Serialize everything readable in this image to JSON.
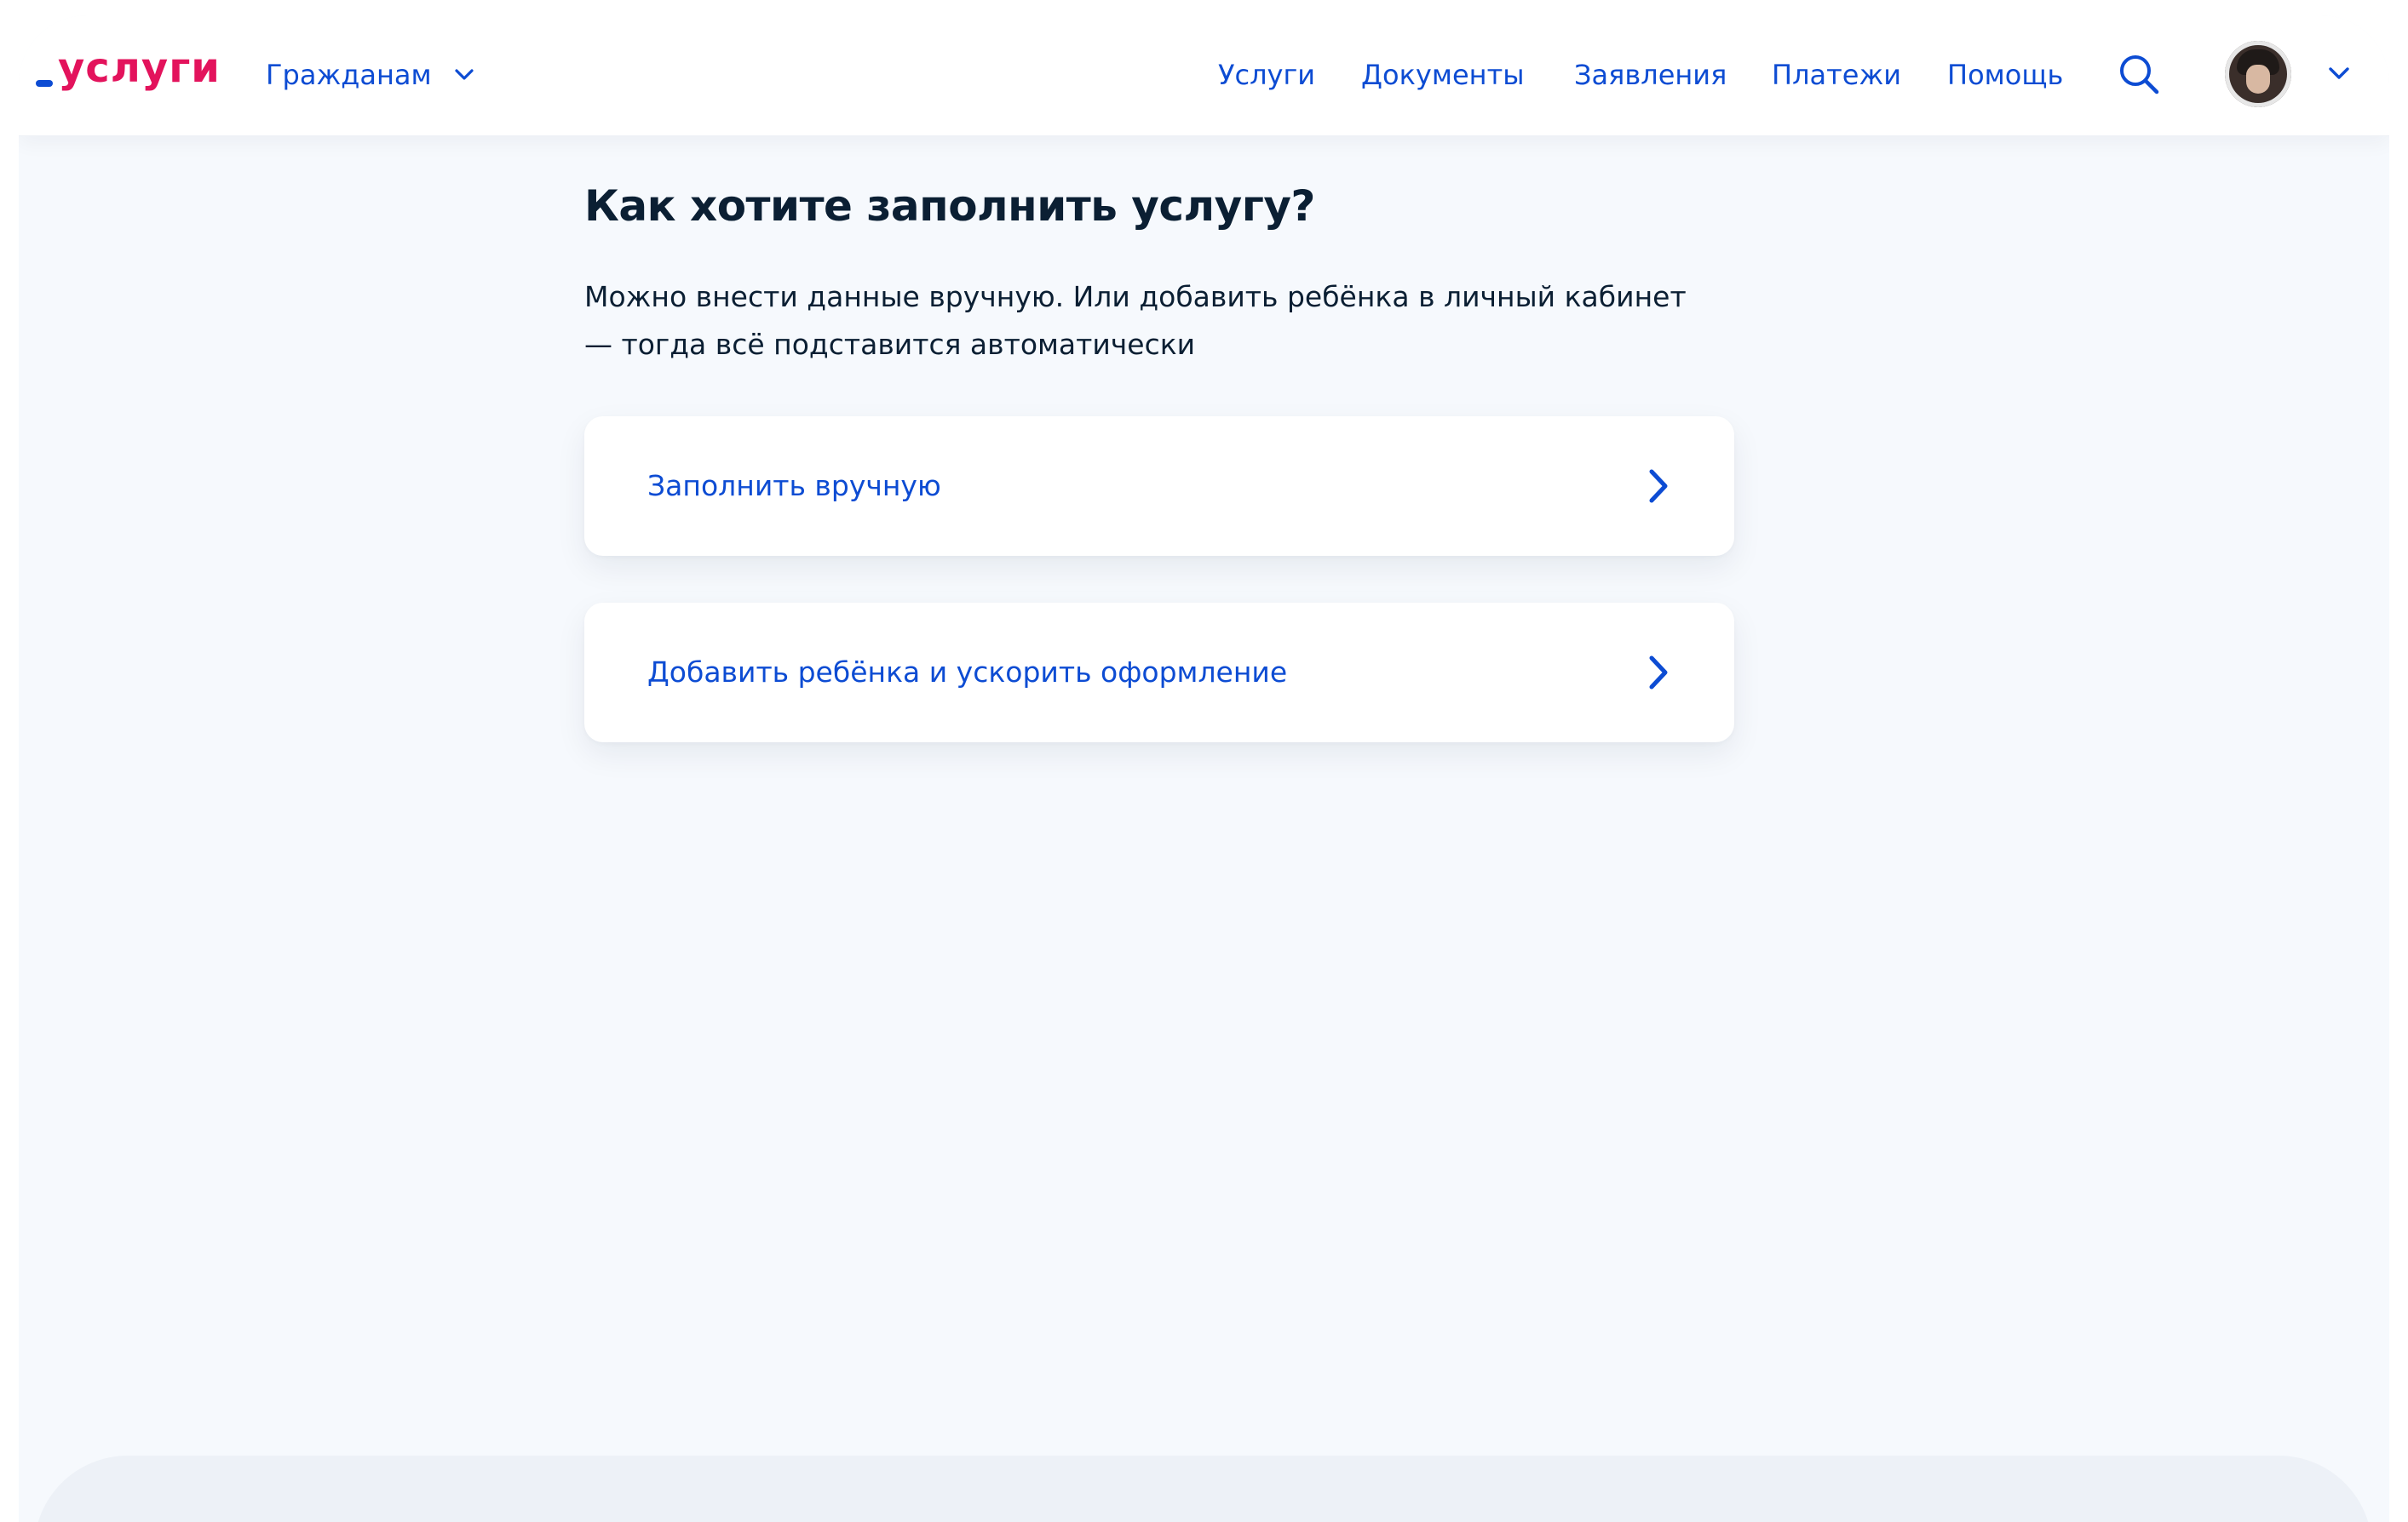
{
  "header": {
    "logo_text": "услуги",
    "audience_label": "Гражданам",
    "nav": [
      "Услуги",
      "Документы",
      "Заявления",
      "Платежи",
      "Помощь"
    ]
  },
  "main": {
    "title": "Как хотите заполнить услугу?",
    "lead": "Можно внести данные вручную. Или добавить ребёнка в личный кабинет — тогда всё подставится автоматически",
    "options": [
      {
        "label": "Заполнить вручную"
      },
      {
        "label": "Добавить ребёнка и ускорить оформление"
      }
    ]
  },
  "icons": {
    "audience_chevron": "chevron-down-icon",
    "search": "search-icon",
    "avatar_chevron": "chevron-down-icon",
    "option_arrow": "chevron-right-icon"
  },
  "colors": {
    "primary_link": "#0d4cd3",
    "brand_red": "#e3135c",
    "text": "#0b1f33",
    "page_bg": "#f6f9fd",
    "card_bg": "#ffffff"
  }
}
